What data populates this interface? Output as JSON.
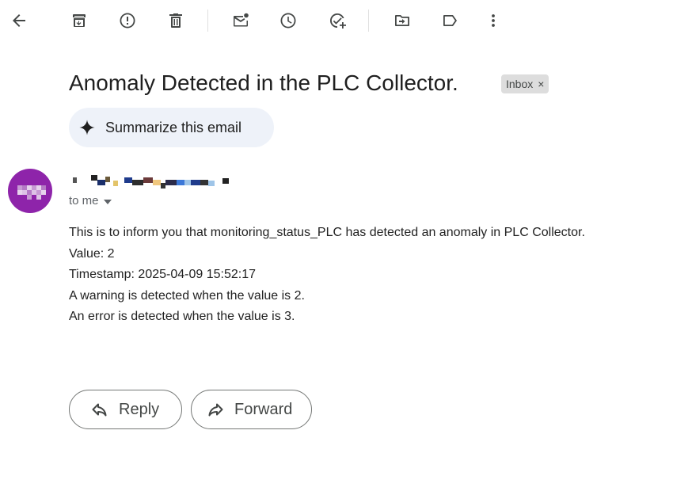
{
  "toolbar": {
    "icons": [
      "back-arrow-icon",
      "archive-icon",
      "report-spam-icon",
      "delete-icon",
      "mark-unread-icon",
      "snooze-icon",
      "add-to-tasks-icon",
      "move-to-icon",
      "label-icon",
      "more-icon"
    ]
  },
  "email": {
    "subject": "Anomaly Detected in the PLC Collector.",
    "label": "Inbox",
    "label_remove": "×",
    "summarize_label": "Summarize this email",
    "recipient": "to me",
    "body_lines": [
      "This is to inform you that monitoring_status_PLC has detected an anomaly in PLC Collector.",
      "Value: 2",
      "Timestamp: 2025-04-09 15:52:17",
      "A warning is detected when the value is 2.",
      "An error is detected when the value is 3."
    ]
  },
  "actions": {
    "reply_label": "Reply",
    "forward_label": "Forward"
  },
  "colors": {
    "avatar_bg": "#8e24aa",
    "summarize_bg": "#eef2f9",
    "label_chip_bg": "#dddddd"
  }
}
